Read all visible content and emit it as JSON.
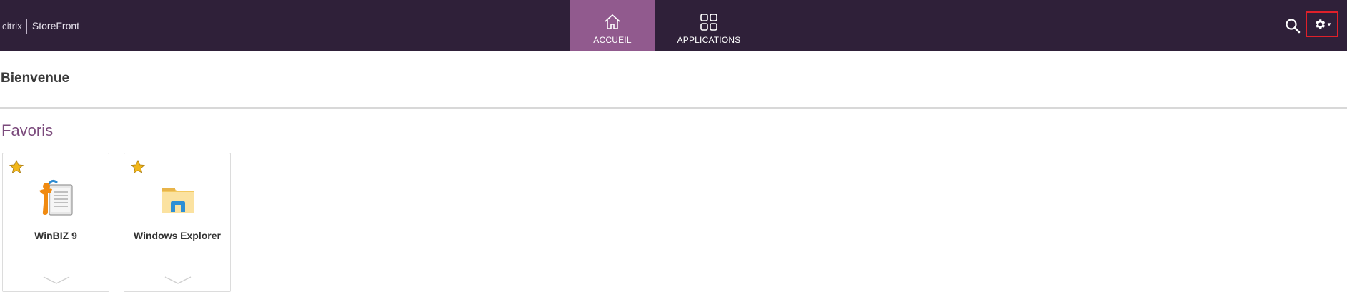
{
  "header": {
    "brand_citrix": "citrix",
    "brand_product": "StoreFront",
    "tabs": [
      {
        "label": "ACCUEIL",
        "icon": "home-icon",
        "active": true
      },
      {
        "label": "APPLICATIONS",
        "icon": "grid-icon",
        "active": false
      }
    ],
    "search_icon": "search-icon",
    "settings_icon": "gear-icon",
    "settings_caret": "▾"
  },
  "main": {
    "welcome": "Bienvenue",
    "favorites_title": "Favoris",
    "favorites": [
      {
        "name": "WinBIZ 9",
        "icon": "winbiz-icon",
        "favorite": true
      },
      {
        "name": "Windows Explorer",
        "icon": "folder-icon",
        "favorite": true
      }
    ]
  },
  "colors": {
    "topbar_bg": "#2f2039",
    "active_tab_bg": "#915a8e",
    "favorites_title": "#7b4a7c",
    "star": "#f2b71a",
    "settings_outline": "#e0202a"
  }
}
